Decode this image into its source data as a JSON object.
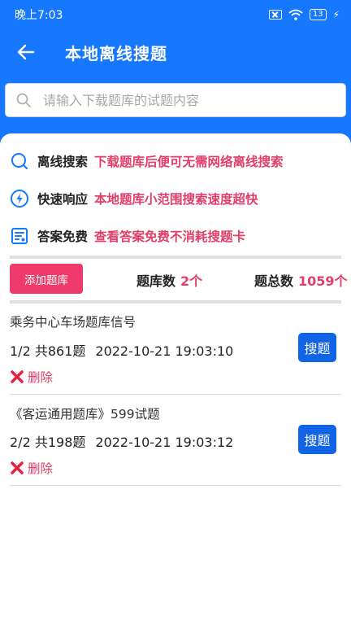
{
  "status_bar": {
    "time": "晚上7:03",
    "battery": "13"
  },
  "app_bar": {
    "title": "本地离线搜题"
  },
  "search": {
    "placeholder": "请输入下载题库的试题内容"
  },
  "features": [
    {
      "icon": "search-icon",
      "name": "离线搜索",
      "desc": "下载题库后便可无需网络离线搜索"
    },
    {
      "icon": "lightning-icon",
      "name": "快速响应",
      "desc": "本地题库小范围搜索速度超快"
    },
    {
      "icon": "document-icon",
      "name": "答案免费",
      "desc": "查看答案免费不消耗搜题卡"
    }
  ],
  "stats": {
    "add_label": "添加题库",
    "bank_count_label": "题库数",
    "bank_count_value": "2个",
    "question_total_label": "题总数",
    "question_total_value": "1059个"
  },
  "banks": [
    {
      "title": "乘务中心车场题库信号",
      "progress": "1/2 共861题",
      "date": "2022-10-21 19:03:10",
      "search_label": "搜题",
      "delete_label": "删除"
    },
    {
      "title": "《客运通用题库》599试题",
      "progress": "2/2 共198题",
      "date": "2022-10-21 19:03:12",
      "search_label": "搜题",
      "delete_label": "删除"
    }
  ],
  "colors": {
    "primary": "#1677ff",
    "accent": "#e23e6a",
    "button_blue": "#1264e6"
  }
}
